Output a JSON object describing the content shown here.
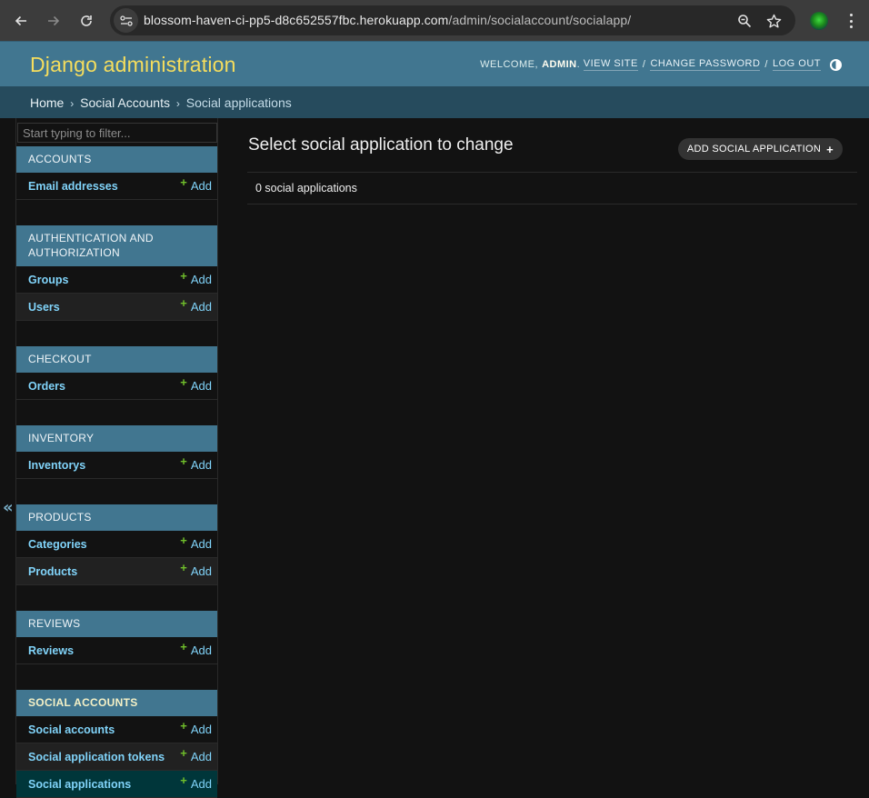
{
  "browser": {
    "url_host": "blossom-haven-ci-pp5-d8c652557fbc.herokuapp.com",
    "url_path": "/admin/socialaccount/socialapp/",
    "icons": {
      "back": "arrow-left-icon",
      "forward": "arrow-right-icon",
      "reload": "reload-icon",
      "site_info": "tune-icon",
      "zoom": "zoom-icon",
      "bookmark": "star-icon",
      "profile": "avatar",
      "menu": "kebab-menu-icon"
    }
  },
  "header": {
    "branding": "Django administration",
    "welcome": "WELCOME,",
    "username": "ADMIN",
    "view_site": "VIEW SITE",
    "change_password": "CHANGE PASSWORD",
    "log_out": "LOG OUT",
    "separator": "/"
  },
  "breadcrumbs": {
    "items": [
      "Home",
      "Social Accounts",
      "Social applications"
    ],
    "separator": "›"
  },
  "sidebar": {
    "filter_placeholder": "Start typing to filter...",
    "collapse_label": "«",
    "add_label": "Add",
    "modules": [
      {
        "caption": "ACCOUNTS",
        "models": [
          {
            "name": "Email addresses"
          }
        ]
      },
      {
        "caption": "AUTHENTICATION AND AUTHORIZATION",
        "models": [
          {
            "name": "Groups"
          },
          {
            "name": "Users"
          }
        ]
      },
      {
        "caption": "CHECKOUT",
        "models": [
          {
            "name": "Orders"
          }
        ]
      },
      {
        "caption": "INVENTORY",
        "models": [
          {
            "name": "Inventorys"
          }
        ]
      },
      {
        "caption": "PRODUCTS",
        "models": [
          {
            "name": "Categories"
          },
          {
            "name": "Products"
          }
        ]
      },
      {
        "caption": "REVIEWS",
        "models": [
          {
            "name": "Reviews"
          }
        ]
      },
      {
        "caption": "SOCIAL ACCOUNTS",
        "current": true,
        "models": [
          {
            "name": "Social accounts"
          },
          {
            "name": "Social application tokens"
          },
          {
            "name": "Social applications",
            "current": true
          }
        ]
      }
    ]
  },
  "content": {
    "title": "Select social application to change",
    "add_button": "ADD SOCIAL APPLICATION",
    "result_count": "0 social applications"
  },
  "colors": {
    "header_bg": "#417690",
    "branding": "#f5dd5d",
    "breadcrumbs_bg": "#264b5d",
    "link": "#81d4fa",
    "add_plus": "#70bf2b",
    "current_row": "#00363a",
    "background": "#121212"
  }
}
